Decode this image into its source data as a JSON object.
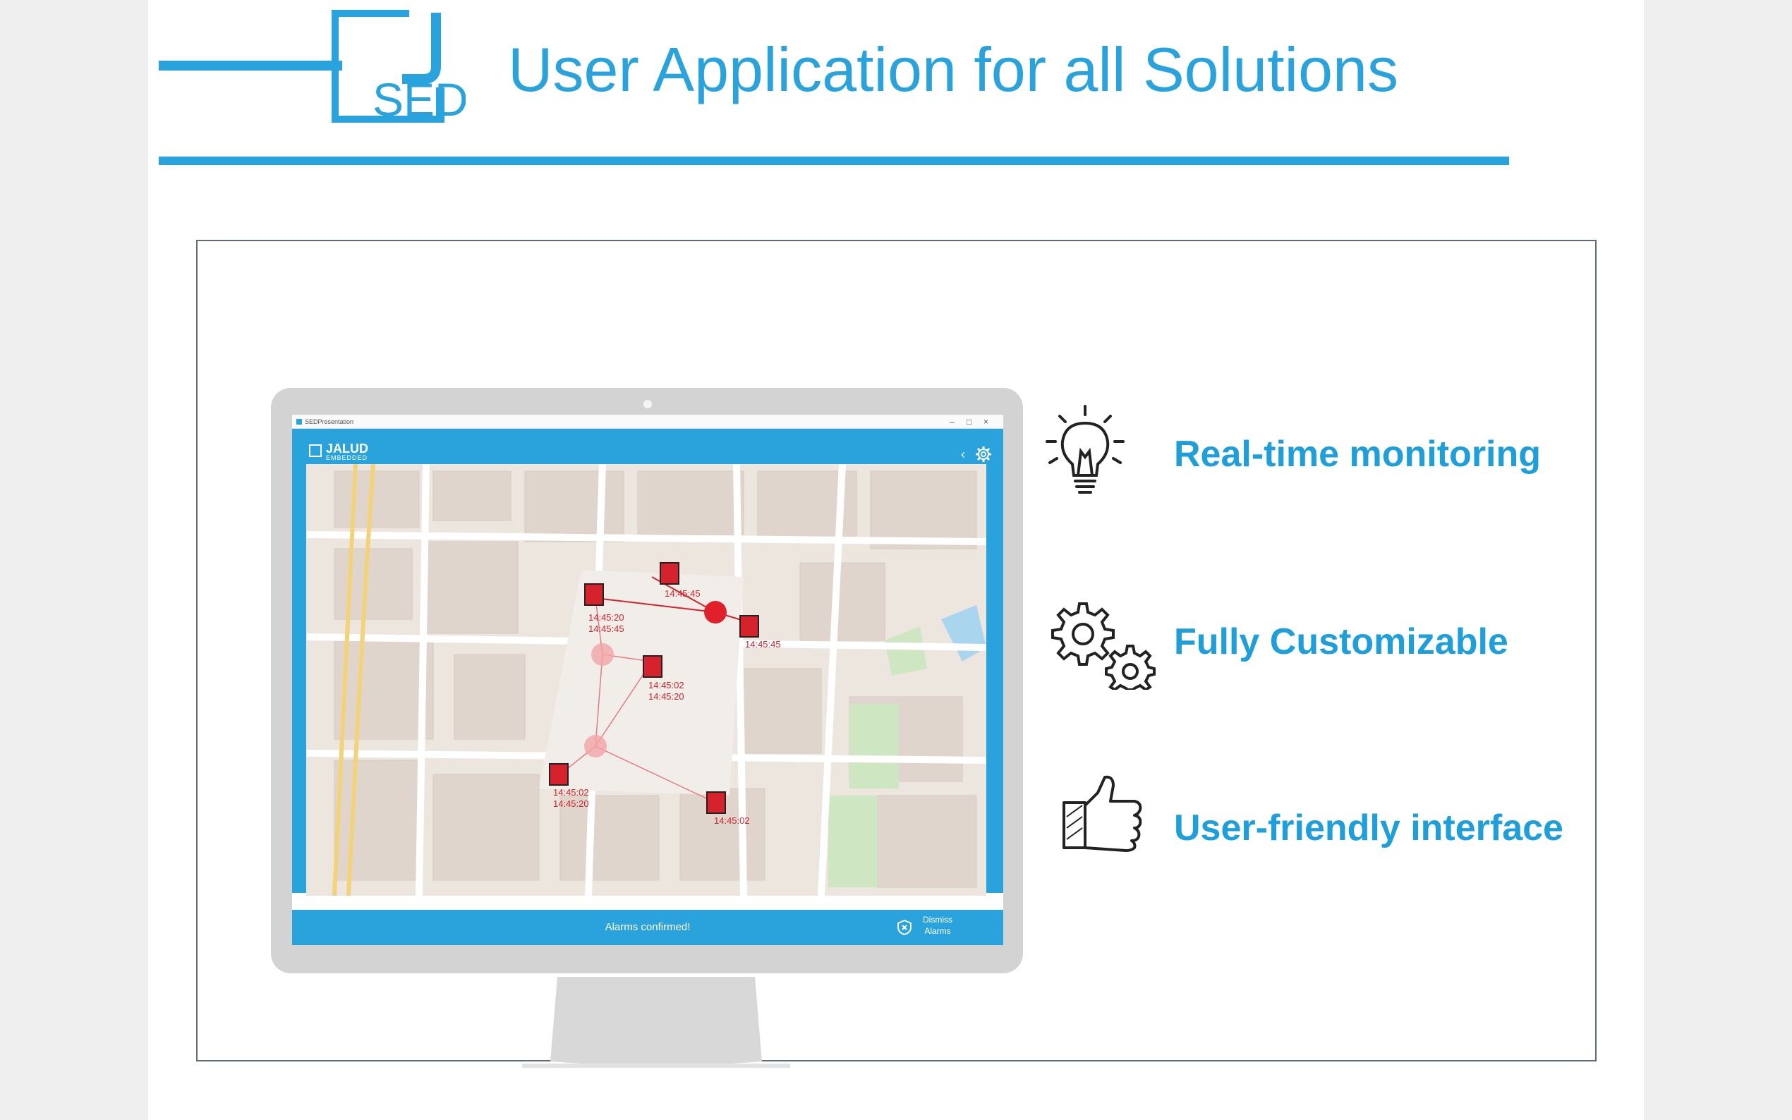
{
  "slide": {
    "title": "User Application for all Solutions",
    "logo_text": "SED"
  },
  "colors": {
    "accent": "#29a3dd",
    "feature_text": "#1d9fdb",
    "alarm_red": "#d6222c"
  },
  "app": {
    "window_title": "SEDPresentation",
    "brand": "JALUD",
    "brand_sub": "EMBEDDED",
    "footer_message": "Alarms confirmed!",
    "dismiss_label_1": "Dismiss",
    "dismiss_label_2": "Alarms",
    "markers": [
      {
        "id": "m1",
        "times": [
          "14:45:20",
          "14:45:45"
        ]
      },
      {
        "id": "m2",
        "times": [
          "14:45:45"
        ]
      },
      {
        "id": "m3",
        "times": [
          "14:45:45"
        ]
      },
      {
        "id": "m4",
        "times": [
          "14:45:02",
          "14:45:20"
        ]
      },
      {
        "id": "m5",
        "times": [
          "14:45:02",
          "14:45:20"
        ]
      },
      {
        "id": "m6",
        "times": [
          "14:45:02"
        ]
      }
    ]
  },
  "features": [
    {
      "label": "Real-time monitoring",
      "icon": "lightbulb-icon"
    },
    {
      "label": "Fully Customizable",
      "icon": "gears-icon"
    },
    {
      "label": "User-friendly interface",
      "icon": "thumbs-up-icon"
    }
  ]
}
